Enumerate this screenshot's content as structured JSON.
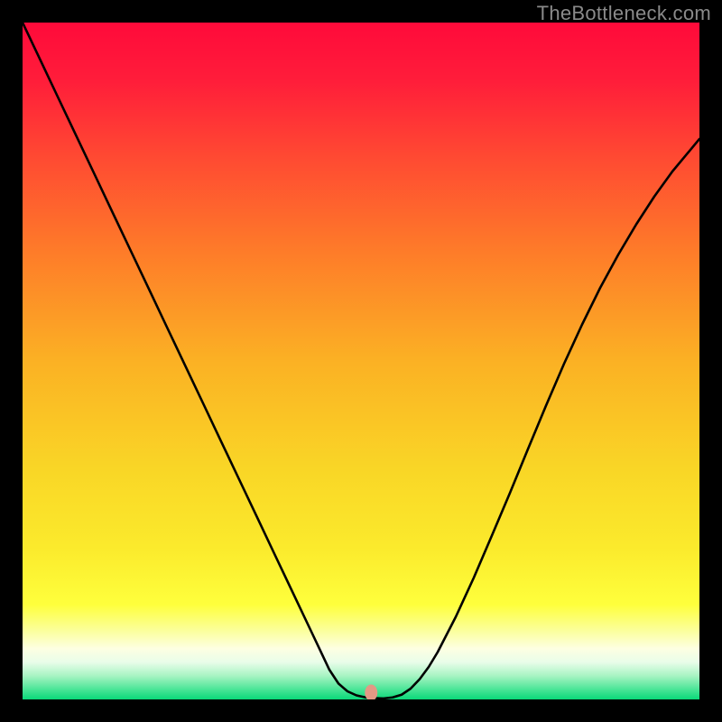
{
  "watermark_text": "TheBottleneck.com",
  "chart_data": {
    "type": "line",
    "title": "",
    "xlabel": "",
    "ylabel": "",
    "xlim": [
      0,
      100
    ],
    "ylim": [
      0,
      100
    ],
    "grid": false,
    "series": [
      {
        "name": "curve",
        "x": [
          0,
          2.67,
          5.33,
          8,
          10.67,
          13.33,
          16,
          18.67,
          21.33,
          24,
          26.67,
          29.33,
          32,
          34.67,
          37.33,
          40,
          42.67,
          44,
          45.33,
          46.67,
          48,
          49.33,
          50.67,
          52,
          53.33,
          54.67,
          56,
          57.33,
          58.67,
          60,
          61.33,
          64,
          66.67,
          69.33,
          72,
          74.67,
          77.33,
          80,
          82.67,
          85.33,
          88,
          90.67,
          93.33,
          96,
          100
        ],
        "y": [
          100,
          94.38,
          88.75,
          83.13,
          77.5,
          71.88,
          66.25,
          60.63,
          55,
          49.38,
          43.75,
          38.13,
          32.5,
          26.88,
          21.25,
          15.63,
          10,
          7.19,
          4.38,
          2.35,
          1.2,
          0.6,
          0.3,
          0.2,
          0.15,
          0.3,
          0.7,
          1.6,
          3,
          4.8,
          7,
          12.2,
          18,
          24.2,
          30.5,
          37,
          43.4,
          49.6,
          55.4,
          60.8,
          65.7,
          70.2,
          74.3,
          78,
          82.8
        ]
      }
    ],
    "annotations": [
      {
        "name": "marker",
        "x": 51.5,
        "y": 1.0,
        "color": "#e29985",
        "rx": 7,
        "ry": 9
      }
    ],
    "gradient_stops": [
      {
        "offset": 0.0,
        "color": "#ff0a3a"
      },
      {
        "offset": 0.085,
        "color": "#ff1d3a"
      },
      {
        "offset": 0.2,
        "color": "#ff4a32"
      },
      {
        "offset": 0.34,
        "color": "#fe7c29"
      },
      {
        "offset": 0.5,
        "color": "#fbb124"
      },
      {
        "offset": 0.66,
        "color": "#f9d626"
      },
      {
        "offset": 0.775,
        "color": "#fbea2c"
      },
      {
        "offset": 0.86,
        "color": "#feff3c"
      },
      {
        "offset": 0.9,
        "color": "#fbffa0"
      },
      {
        "offset": 0.925,
        "color": "#fdffe2"
      },
      {
        "offset": 0.945,
        "color": "#e9fde9"
      },
      {
        "offset": 0.965,
        "color": "#a8f4c3"
      },
      {
        "offset": 0.985,
        "color": "#4be597"
      },
      {
        "offset": 1.0,
        "color": "#0ad879"
      }
    ]
  }
}
